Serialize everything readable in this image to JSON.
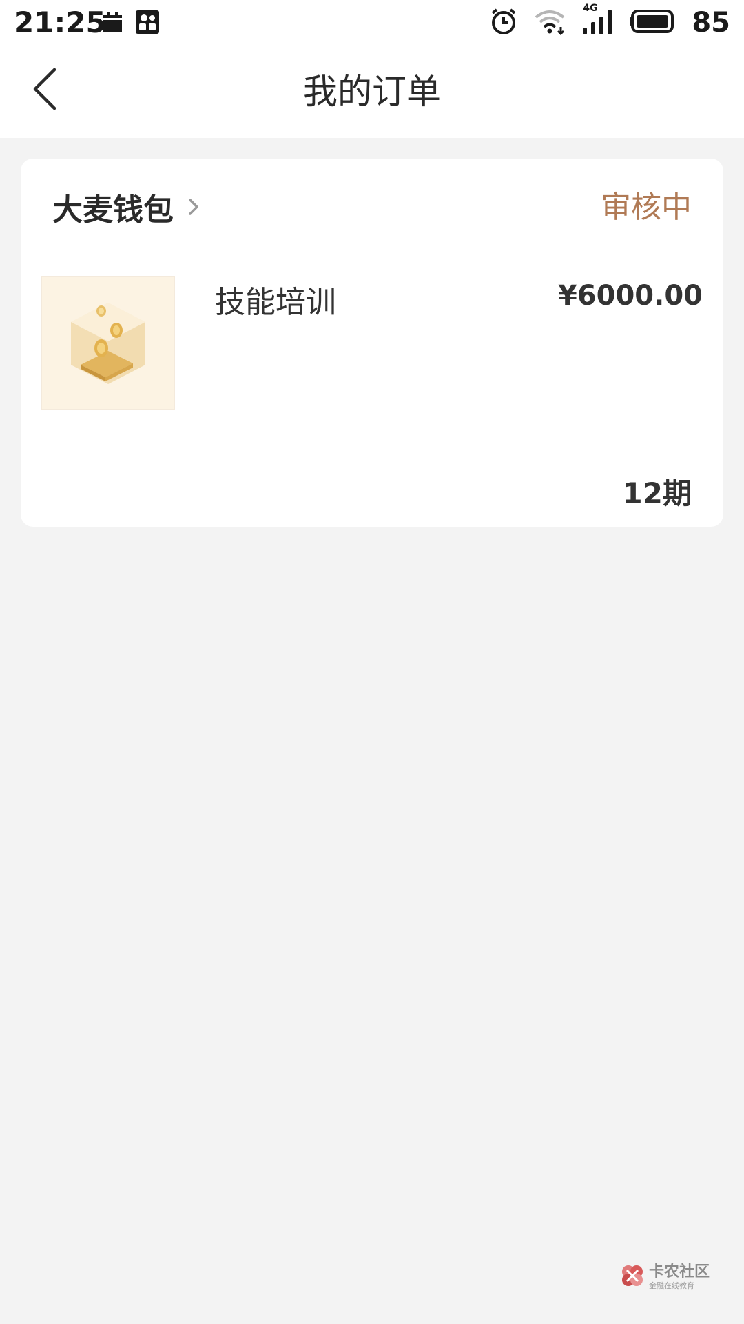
{
  "status_bar": {
    "time": "21:25",
    "network_label": "4G",
    "battery_level": "85"
  },
  "nav": {
    "title": "我的订单",
    "back_icon": "chevron-left-icon"
  },
  "order": {
    "merchant_name": "大麦钱包",
    "status": "审核中",
    "product_name": "技能培训",
    "price": "¥6000.00",
    "installments": "12期"
  },
  "watermark": {
    "title": "卡农社区",
    "subtitle": "金融在线教育"
  },
  "colors": {
    "status_accent": "#b07a55",
    "page_background": "#f3f3f3",
    "card_background": "#ffffff"
  }
}
